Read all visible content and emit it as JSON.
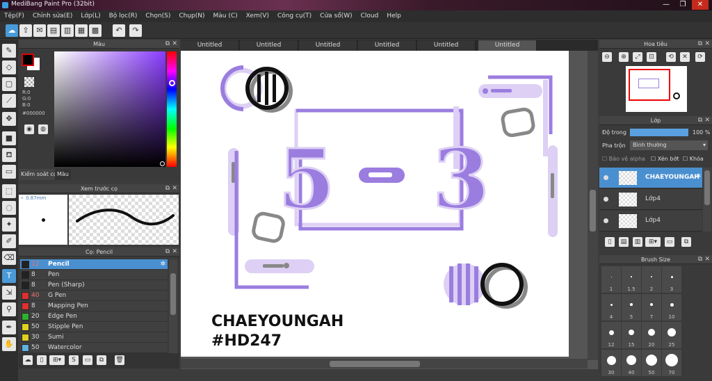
{
  "window": {
    "title": "MediBang Paint Pro (32bit)",
    "min": "—",
    "max": "❐",
    "close": "✕"
  },
  "menu": [
    "Tệp(F)",
    "Chỉnh sửa(E)",
    "Lớp(L)",
    "Bộ lọc(R)",
    "Chọn(S)",
    "Chụp(N)",
    "Màu (C)",
    "Xem(V)",
    "Công cụ(T)",
    "Cửa sổ(W)",
    "Cloud",
    "Help"
  ],
  "color_panel": {
    "title": "Màu",
    "r": "R:0",
    "g": "G:0",
    "b": "B:0",
    "hex": "#000000",
    "tabs": [
      "Kiểm soát cọ",
      "Màu"
    ],
    "fg": "#000000",
    "bg": "#ffffff"
  },
  "brush_preview": {
    "title": "Xem trước cọ",
    "size": "0.87mm"
  },
  "brush_list": {
    "title": "Cọ: Pencil",
    "items": [
      {
        "size": "12",
        "name": "Pencil",
        "color": "#222222"
      },
      {
        "size": "8",
        "name": "Pen",
        "color": "#222222"
      },
      {
        "size": "8",
        "name": "Pen (Sharp)",
        "color": "#222222"
      },
      {
        "size": "40",
        "name": "G Pen",
        "color": "#e03030"
      },
      {
        "size": "8",
        "name": "Mapping Pen",
        "color": "#e03030"
      },
      {
        "size": "20",
        "name": "Edge Pen",
        "color": "#30b030"
      },
      {
        "size": "50",
        "name": "Stipple Pen",
        "color": "#e0d020"
      },
      {
        "size": "30",
        "name": "Sumi",
        "color": "#e0d020"
      },
      {
        "size": "50",
        "name": "Watercolor",
        "color": "#60b0e0"
      }
    ]
  },
  "tabs": [
    "Untitled",
    "Untitled",
    "Untitled",
    "Untitled",
    "Untitled",
    "Untitled"
  ],
  "canvas": {
    "big_text_left": "5",
    "big_text_right": "3",
    "caption_line1": "CHAEYOUNGAH",
    "caption_line2": "#HD247",
    "accent": "#9b7de0",
    "light_accent": "#ddd0f4"
  },
  "navigator": {
    "title": "Hoa tiêu"
  },
  "layers": {
    "title": "Lớp",
    "opacity_label": "Độ trong",
    "opacity_value": "100 %",
    "blend_label": "Pha trộn",
    "blend_value": "Bình thường",
    "opt_alpha": "Bảo vệ alpha",
    "opt_clip": "Xén bớt",
    "opt_lock": "Khóa",
    "items": [
      "CHAEYOUNGAH",
      "Lớp4",
      "Lớp4"
    ]
  },
  "brush_size": {
    "title": "Brush Size",
    "sizes": [
      "1",
      "1.5",
      "2",
      "3",
      "4",
      "5",
      "7",
      "10",
      "12",
      "15",
      "20",
      "25",
      "30",
      "40",
      "50",
      "70"
    ]
  }
}
